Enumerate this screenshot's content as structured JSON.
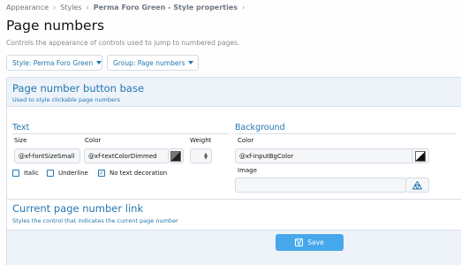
{
  "breadcrumb": [
    "Appearance",
    "Styles",
    "Perma Foro Green - Style properties"
  ],
  "page": {
    "title": "Page numbers",
    "description": "Controls the appearance of controls used to jump to numbered pages."
  },
  "filters": {
    "style_label": "Style: Perma Foro Green",
    "group_label": "Group: Page numbers"
  },
  "sections": {
    "base": {
      "title": "Page number button base",
      "subtitle": "Used to style clickable page numbers"
    },
    "current": {
      "title": "Current page number link",
      "subtitle": "Styles the control that indicates the current page number"
    }
  },
  "text_group": {
    "title": "Text",
    "size_label": "Size",
    "size_value": "@xf-fontSizeSmall",
    "color_label": "Color",
    "color_value": "@xf-textColorDimmed",
    "weight_label": "Weight",
    "options": [
      {
        "label": "Italic",
        "checked": false
      },
      {
        "label": "Underline",
        "checked": false
      },
      {
        "label": "No text decoration",
        "checked": true
      }
    ]
  },
  "background_group": {
    "title": "Background",
    "color_label": "Color",
    "color_value": "@xf-inputBgColor",
    "image_label": "Image",
    "image_value": ""
  },
  "footer": {
    "save_label": "Save"
  },
  "colors": {
    "accent": "#2577b1",
    "header_bg": "#edf3f9",
    "save_bg": "#47a7eb"
  }
}
